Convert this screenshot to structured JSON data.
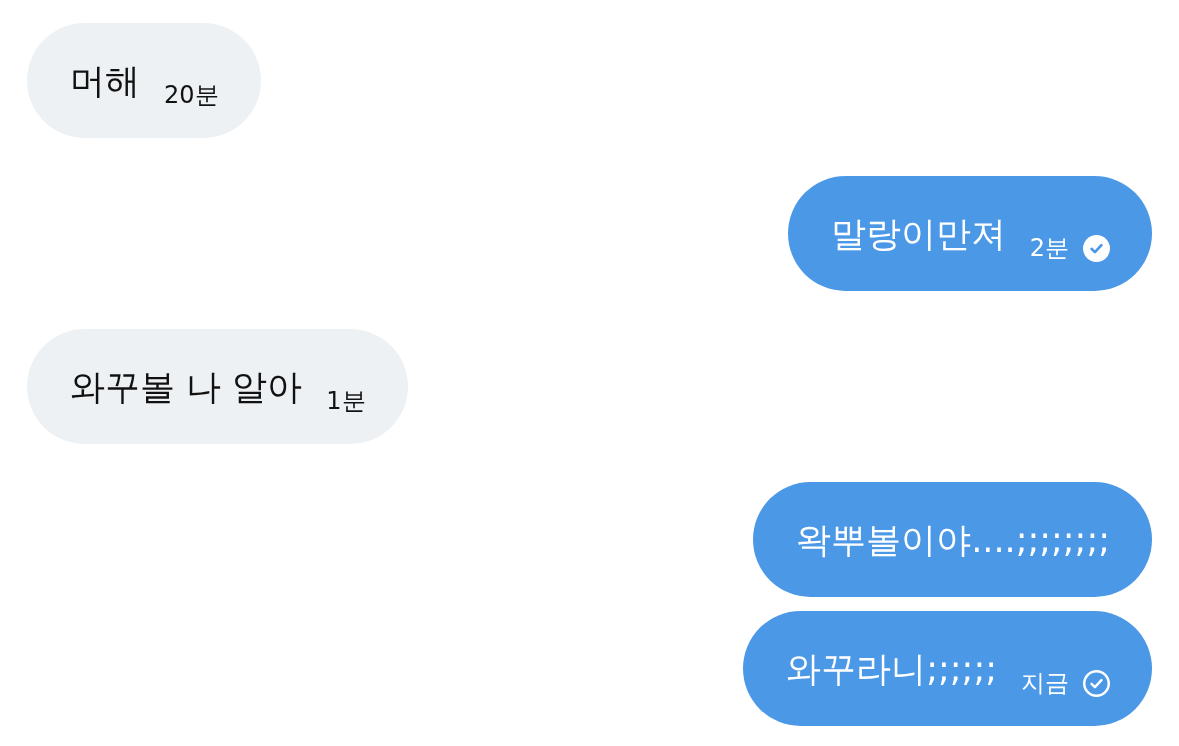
{
  "messages": [
    {
      "kind": "received",
      "text": "머해",
      "time": "20분"
    },
    {
      "kind": "sent",
      "text": "말랑이만져",
      "time": "2분",
      "read": true
    },
    {
      "kind": "received",
      "text": "와꾸볼 나 알아",
      "time": "1분"
    },
    {
      "kind": "sent",
      "text": "왁뿌볼이야....;;;;;;;;"
    },
    {
      "kind": "sent",
      "text": "와꾸라니;;;;;;",
      "time": "지금",
      "read": false
    }
  ]
}
